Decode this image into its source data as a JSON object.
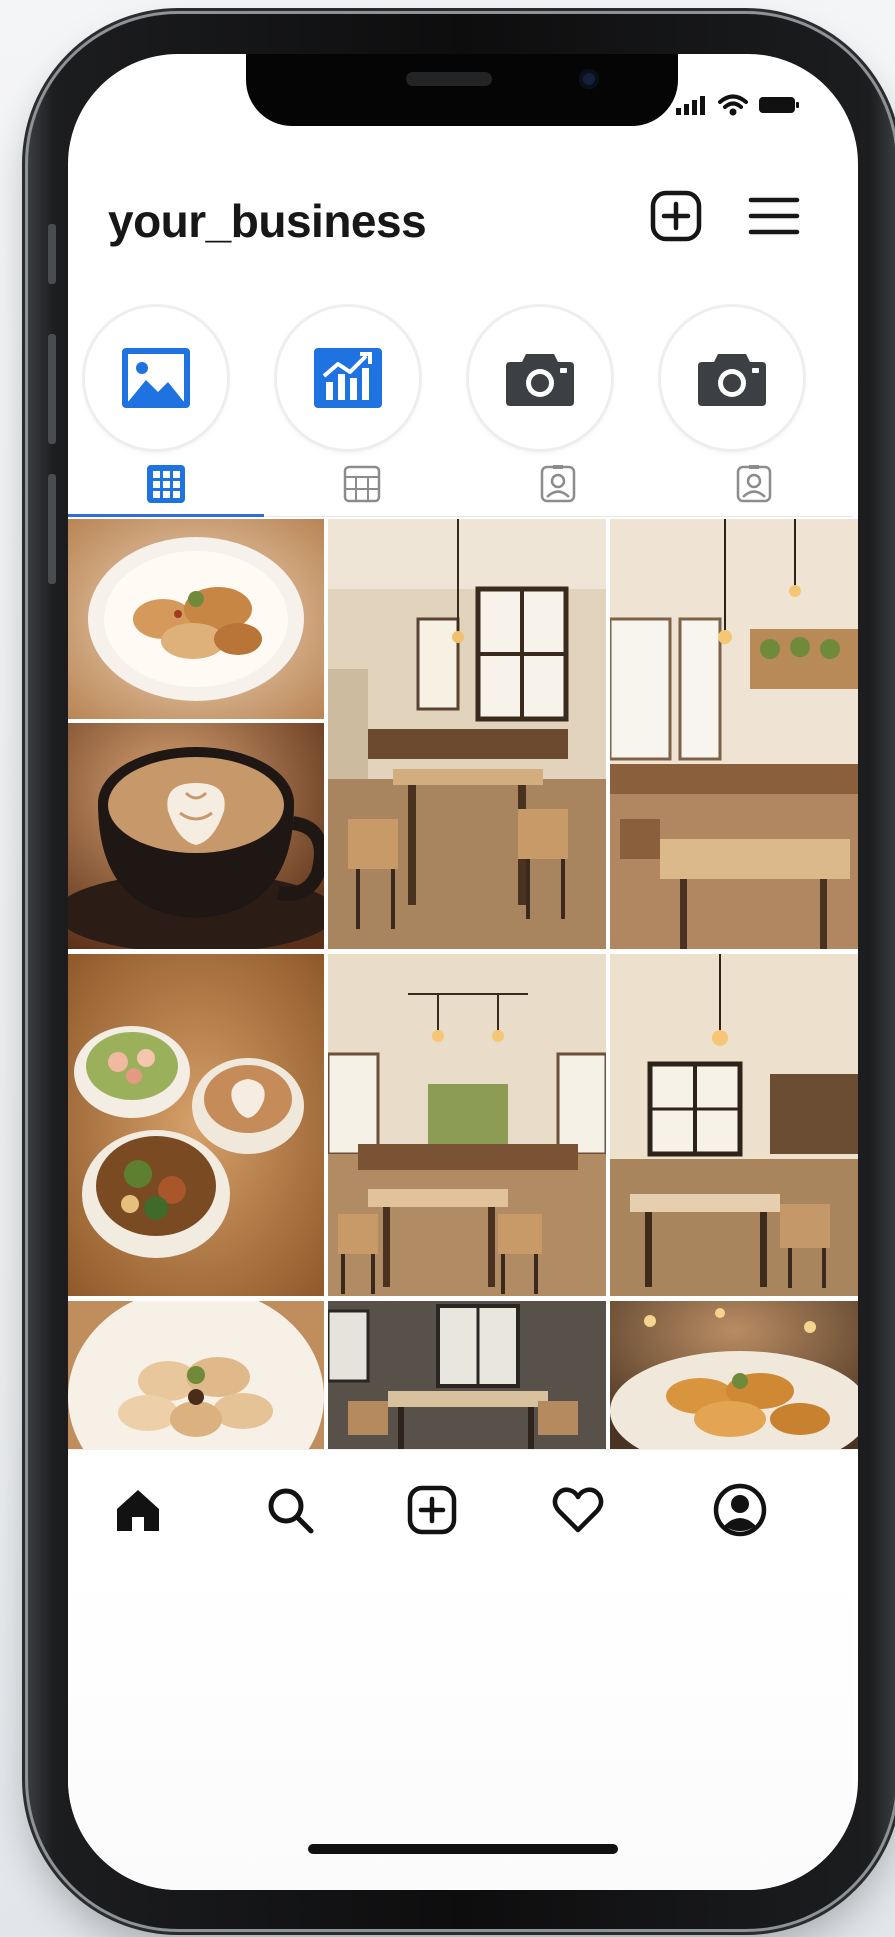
{
  "profile": {
    "username": "your_business"
  },
  "header_icons": {
    "new_post": "plus-square-icon",
    "menu": "hamburger-menu-icon"
  },
  "status_bar": {
    "signal": "signal-icon",
    "wifi": "wifi-icon",
    "battery": "battery-icon"
  },
  "highlights": [
    {
      "icon": "image-icon",
      "accent": "#1f73e0"
    },
    {
      "icon": "chart-icon",
      "accent": "#1f73e0"
    },
    {
      "icon": "camera-icon",
      "accent": "#3c3f44"
    },
    {
      "icon": "camera-icon",
      "accent": "#3c3f44"
    }
  ],
  "tabs": [
    {
      "icon": "grid-icon",
      "active": true
    },
    {
      "icon": "reels-icon",
      "active": false
    },
    {
      "icon": "tagged-icon",
      "active": false
    },
    {
      "icon": "tagged-icon",
      "active": false
    }
  ],
  "grid_posts": [
    {
      "subject": "dumplings-plate"
    },
    {
      "subject": "latte-art-cup"
    },
    {
      "subject": "cafe-interior-window"
    },
    {
      "subject": "cafe-interior-pendant-lights"
    },
    {
      "subject": "salad-and-latte-table"
    },
    {
      "subject": "cafe-dining-room"
    },
    {
      "subject": "cafe-dining-room-windows"
    },
    {
      "subject": "dumplings-plate-closeup"
    },
    {
      "subject": "cafe-dark-interior"
    },
    {
      "subject": "fried-dumplings-plate"
    }
  ],
  "bottom_nav": [
    {
      "icon": "home-icon",
      "active": true
    },
    {
      "icon": "search-icon",
      "active": false
    },
    {
      "icon": "add-post-icon",
      "active": false
    },
    {
      "icon": "heart-icon",
      "active": false
    },
    {
      "icon": "profile-icon",
      "active": false
    }
  ],
  "colors": {
    "accent": "#2d6fd8",
    "text": "#171717",
    "icon_dark": "#1a1a1a",
    "warm_tone": "#c89a6c"
  }
}
